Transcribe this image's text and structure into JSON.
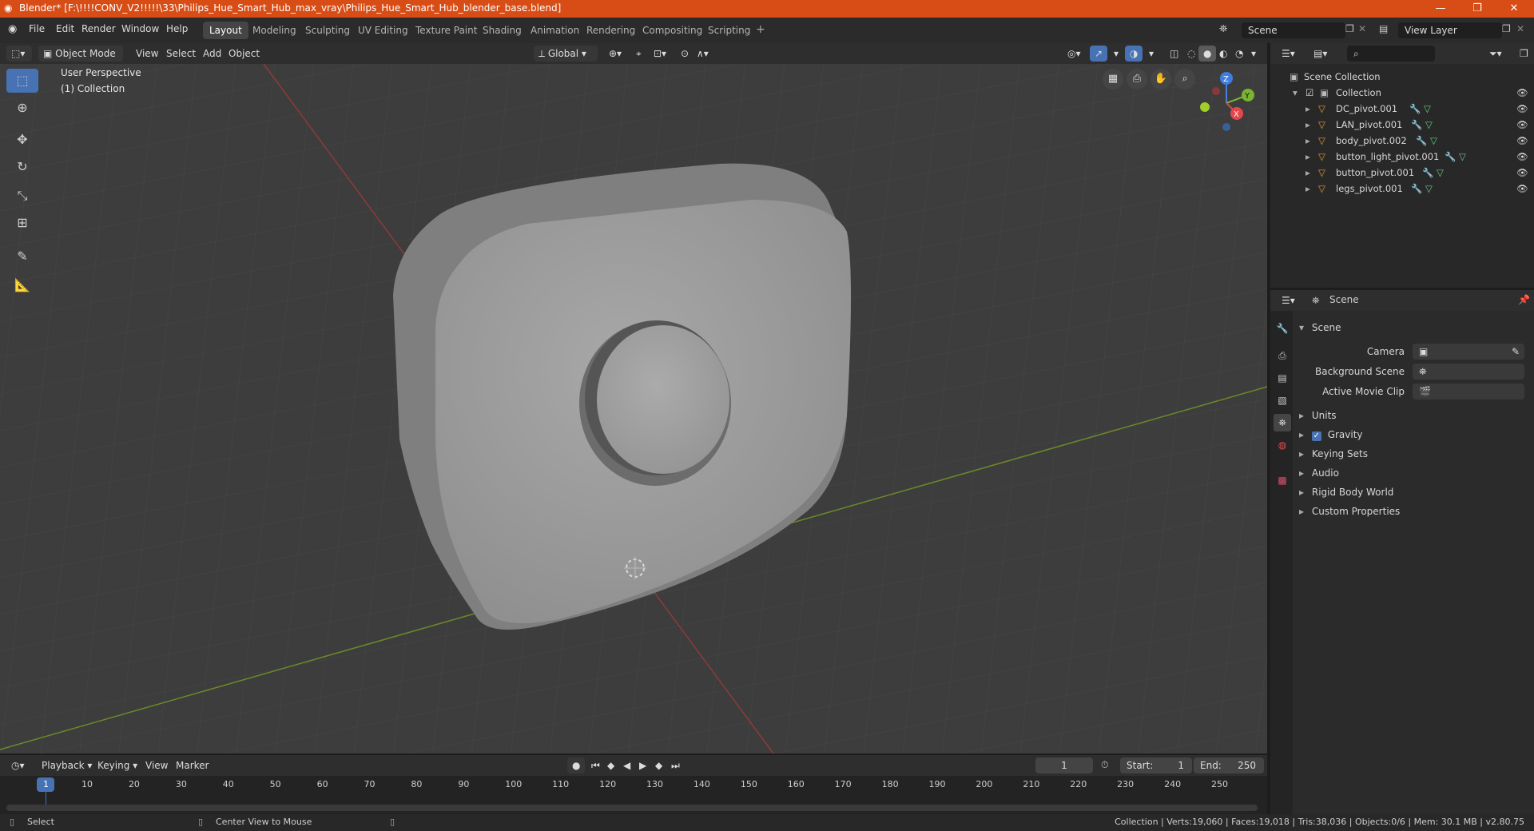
{
  "window": {
    "title": "Blender* [F:\\!!!!CONV_V2!!!!!\\33\\Philips_Hue_Smart_Hub_max_vray\\Philips_Hue_Smart_Hub_blender_base.blend]",
    "minimize": "—",
    "maximize": "❐",
    "close": "✕"
  },
  "menu": [
    "File",
    "Edit",
    "Render",
    "Window",
    "Help"
  ],
  "workspaces": [
    {
      "label": "Layout",
      "active": true
    },
    {
      "label": "Modeling"
    },
    {
      "label": "Sculpting"
    },
    {
      "label": "UV Editing"
    },
    {
      "label": "Texture Paint"
    },
    {
      "label": "Shading"
    },
    {
      "label": "Animation"
    },
    {
      "label": "Rendering"
    },
    {
      "label": "Compositing"
    },
    {
      "label": "Scripting"
    }
  ],
  "scene_field": "Scene",
  "view_layer_field": "View Layer",
  "viewport_header": {
    "mode": "Object Mode",
    "menus": [
      "View",
      "Select",
      "Add",
      "Object"
    ],
    "orientation": "Global"
  },
  "viewport": {
    "perspective_label": "User Perspective",
    "collection_label": "(1) Collection",
    "gizmo": {
      "z": "Z",
      "y": "Y",
      "x": "X"
    }
  },
  "outliner": {
    "root": "Scene Collection",
    "collection": "Collection",
    "items": [
      "DC_pivot.001",
      "LAN_pivot.001",
      "body_pivot.002",
      "button_light_pivot.001",
      "button_pivot.001",
      "legs_pivot.001"
    ]
  },
  "properties": {
    "header": "Scene",
    "panel": "Scene",
    "fields": [
      {
        "label": "Camera"
      },
      {
        "label": "Background Scene"
      },
      {
        "label": "Active Movie Clip"
      }
    ],
    "sections": [
      "Units",
      "Gravity",
      "Keying Sets",
      "Audio",
      "Rigid Body World",
      "Custom Properties"
    ]
  },
  "timeline": {
    "menus": [
      "Playback",
      "Keying",
      "View",
      "Marker"
    ],
    "current_frame": "1",
    "start_label": "Start:",
    "start": "1",
    "end_label": "End:",
    "end": "250",
    "ticks": [
      "1",
      "10",
      "20",
      "30",
      "40",
      "50",
      "60",
      "70",
      "80",
      "90",
      "100",
      "110",
      "120",
      "130",
      "140",
      "150",
      "160",
      "170",
      "180",
      "190",
      "200",
      "210",
      "220",
      "230",
      "240",
      "250"
    ]
  },
  "statusbar": {
    "select": "Select",
    "center": "Center View to Mouse",
    "stats": "Collection | Verts:19,060 | Faces:19,018 | Tris:38,036 | Objects:0/6 | Mem: 30.1 MB | v2.80.75"
  },
  "colors": {
    "titlebar": "#d84d16",
    "accent": "#4772b3",
    "viewport": "#3d3d3d"
  }
}
